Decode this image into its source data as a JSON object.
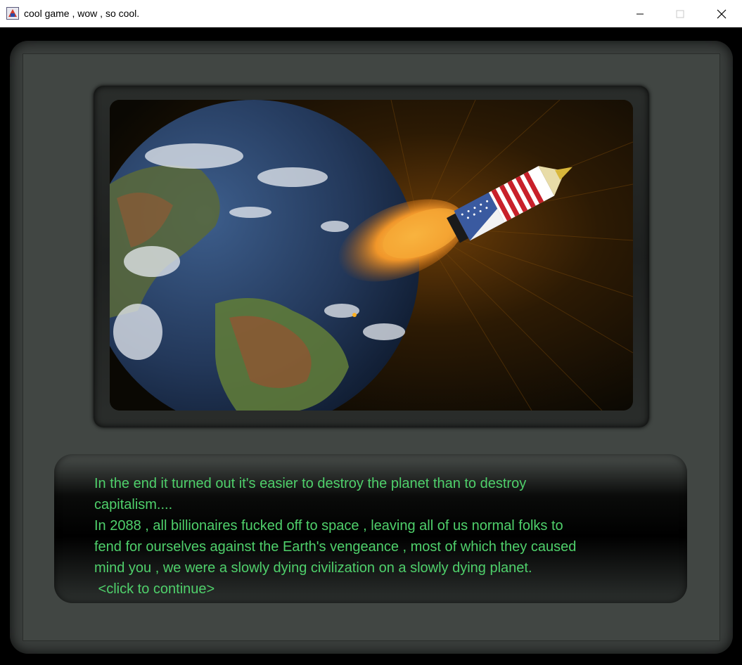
{
  "window": {
    "title": "cool game , wow , so cool.",
    "icon": "java-app-icon",
    "controls": {
      "minimize_icon": "minimize-icon",
      "maximize_icon": "maximize-icon",
      "close_icon": "close-icon"
    }
  },
  "scene": {
    "elements": [
      "earth",
      "rocket-with-us-flag",
      "rocket-flame",
      "sun-rays"
    ],
    "colors": {
      "frame": "#3a3e3c",
      "panel": "#414643",
      "space": "#100c04",
      "text": "#4fd06b"
    }
  },
  "dialog": {
    "lines": [
      "In the end it turned out it's easier to destroy the planet than to destroy",
      "capitalism....",
      "In 2088 , all billionaires fucked off to space , leaving all of us normal folks to",
      "fend for ourselves against the Earth's vengeance , most of which they caused",
      "mind you , we were a slowly dying civilization on a slowly dying planet."
    ],
    "continue_prompt": " <click to continue>"
  }
}
